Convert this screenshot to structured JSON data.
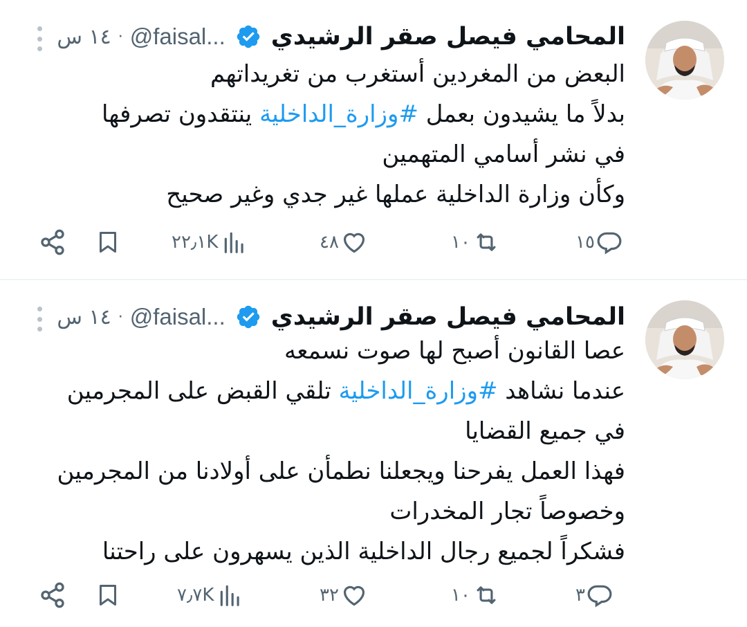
{
  "colors": {
    "text": "#0f1419",
    "secondary": "#536471",
    "link": "#1d9bf0",
    "verified_badge": "#1d9bf0",
    "divider": "#eff3f4"
  },
  "tweets": [
    {
      "author_name": "المحامي فيصل صقر الرشيدي",
      "handle": "@faisal...",
      "separator": "·",
      "time": "١٤ س",
      "lines": [
        {
          "before": "البعض من المغردين أستغرب من تغريداتهم",
          "tag": "",
          "after": ""
        },
        {
          "before": "بدلاً ما يشيدون بعمل ",
          "tag": "#وزارة_الداخلية",
          "after": "  ينتقدون تصرفها"
        },
        {
          "before": "في نشر أسامي المتهمين",
          "tag": "",
          "after": ""
        },
        {
          "before": "وكأن وزارة الداخلية عملها غير جدي وغير صحيح",
          "tag": "",
          "after": ""
        }
      ],
      "replies": "١٥",
      "retweets": "١٠",
      "likes": "٤٨",
      "views": "٢٢٫١K"
    },
    {
      "author_name": "المحامي فيصل صقر الرشيدي",
      "handle": "@faisal...",
      "separator": "·",
      "time": "١٤ س",
      "lines": [
        {
          "before": "عصا القانون أصبح لها صوت نسمعه",
          "tag": "",
          "after": ""
        },
        {
          "before": "عندما نشاهد ",
          "tag": "#وزارة_الداخلية",
          "after": "  تلقي القبض على المجرمين"
        },
        {
          "before": "في جميع القضايا",
          "tag": "",
          "after": ""
        },
        {
          "before": "فهذا العمل يفرحنا ويجعلنا نطمأن على أولادنا من المجرمين",
          "tag": "",
          "after": ""
        },
        {
          "before": "وخصوصاً تجار المخدرات",
          "tag": "",
          "after": ""
        },
        {
          "before": "فشكراً لجميع رجال الداخلية الذين يسهرون على راحتنا",
          "tag": "",
          "after": ""
        }
      ],
      "replies": "٣",
      "retweets": "١٠",
      "likes": "٣٢",
      "views": "٧٫٧K"
    }
  ],
  "icons": {
    "more": "more-vertical-icon",
    "verified": "verified-badge-icon",
    "reply": "reply-icon",
    "retweet": "retweet-icon",
    "like": "like-heart-icon",
    "views": "views-bar-chart-icon",
    "bookmark": "bookmark-icon",
    "share": "share-icon"
  }
}
